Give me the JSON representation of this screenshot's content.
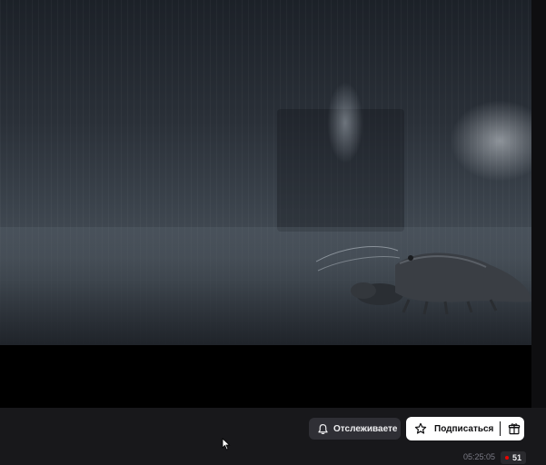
{
  "colors": {
    "page_bg": "#18181b",
    "follow_bg": "#2f2f35",
    "subscribe_bg": "#ffffff",
    "live_dot": "#eb0400"
  },
  "player": {
    "icons": [
      "crayfish-scene"
    ]
  },
  "actions": {
    "follow_label": "Отслеживаете",
    "follow_icon": "bell-icon",
    "subscribe_label": "Подписаться",
    "subscribe_icon": "star-icon",
    "gift_icon": "gift-icon"
  },
  "stats": {
    "uptime": "05:25:05",
    "viewer_count": "51"
  }
}
